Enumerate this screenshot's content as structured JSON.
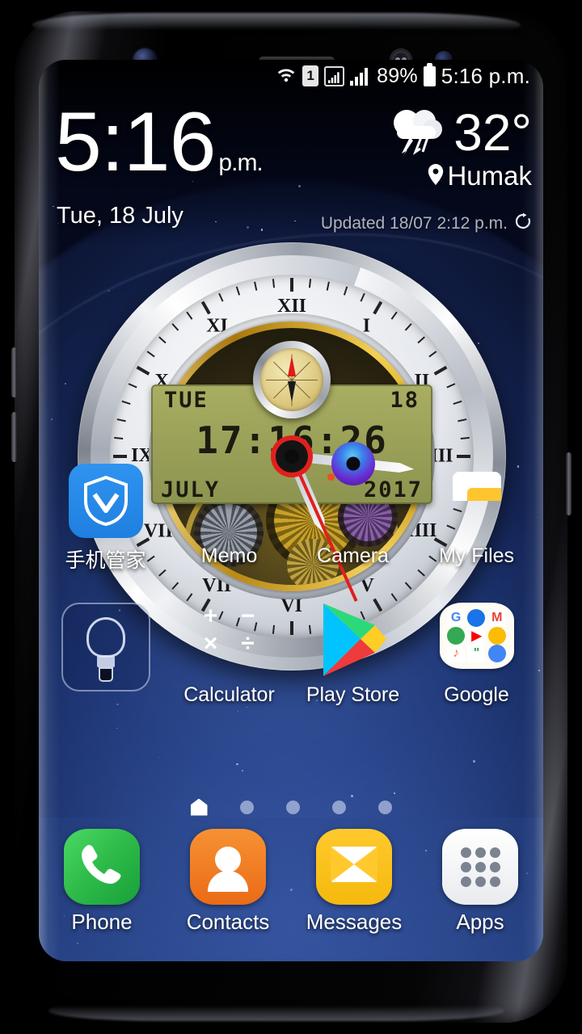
{
  "status_bar": {
    "wifi_icon": "wifi-icon",
    "sim_label": "1",
    "signal_icon_1": "signal-boxed-icon",
    "signal_icon_2": "signal-bars-icon",
    "battery_percent": "89%",
    "battery_icon": "battery-icon",
    "time": "5:16 p.m."
  },
  "clock_widget": {
    "time": "5:16",
    "ampm": "p.m.",
    "date": "Tue, 18 July"
  },
  "weather_widget": {
    "icon": "thunderstorm-cloud-icon",
    "temperature": "32°",
    "location": "Humak",
    "location_pin_icon": "location-pin-icon",
    "updated": "Updated 18/07 2:12 p.m.",
    "refresh_icon": "refresh-icon"
  },
  "analog_clock": {
    "lcd_day": "TUE",
    "lcd_date": "18",
    "lcd_time": "17:16:26",
    "lcd_month": "JULY",
    "lcd_year": "2017",
    "roman_numerals": [
      "XII",
      "I",
      "II",
      "III",
      "IIII",
      "V",
      "VI",
      "VII",
      "VIII",
      "IX",
      "X",
      "XI"
    ],
    "compass_icon": "compass-subdial-icon",
    "hour_angle": 157,
    "minute_angle": 96,
    "second_angle": 156
  },
  "app_rows": [
    [
      {
        "name": "security-manager",
        "label": "手机管家",
        "icon": "shield-icon"
      },
      {
        "name": "memo",
        "label": "Memo",
        "icon": "notepad-icon"
      },
      {
        "name": "camera",
        "label": "Camera",
        "icon": "camera-icon"
      },
      {
        "name": "my-files",
        "label": "My Files",
        "icon": "folder-icon"
      }
    ],
    [
      {
        "name": "flashlight-widget",
        "label": "",
        "icon": "lightbulb-icon"
      },
      {
        "name": "calculator",
        "label": "Calculator",
        "icon": "calculator-icon"
      },
      {
        "name": "play-store",
        "label": "Play Store",
        "icon": "play-store-icon"
      },
      {
        "name": "google-folder",
        "label": "Google",
        "icon": "google-folder-icon"
      }
    ]
  ],
  "calculator_symbols": [
    "+",
    "−",
    "×",
    "÷"
  ],
  "google_folder_apps": [
    {
      "name": "google-search",
      "glyph": "G",
      "color": "#4285F4"
    },
    {
      "name": "chrome",
      "glyph": "",
      "color": "#1a73e8"
    },
    {
      "name": "gmail",
      "glyph": "M",
      "color": "#EA4335"
    },
    {
      "name": "maps",
      "glyph": "",
      "color": "#34A853"
    },
    {
      "name": "youtube",
      "glyph": "▶",
      "color": "#FF0000"
    },
    {
      "name": "drive",
      "glyph": "",
      "color": "#FBBC04"
    },
    {
      "name": "play-music",
      "glyph": "♪",
      "color": "#FF7043"
    },
    {
      "name": "hangouts",
      "glyph": "\"",
      "color": "#34A853"
    },
    {
      "name": "photos",
      "glyph": "",
      "color": "#4285F4"
    }
  ],
  "page_indicator": {
    "home_icon": "home-page-icon",
    "dot_count": 4,
    "current_page": 1,
    "total_pages": 5
  },
  "dock": [
    {
      "name": "phone",
      "label": "Phone",
      "icon": "phone-handset-icon"
    },
    {
      "name": "contacts",
      "label": "Contacts",
      "icon": "person-icon"
    },
    {
      "name": "messages",
      "label": "Messages",
      "icon": "envelope-icon"
    },
    {
      "name": "apps",
      "label": "Apps",
      "icon": "app-drawer-icon"
    }
  ],
  "colors": {
    "accent_blue": "#2f93f0",
    "wallpaper_blue": "#2b4586",
    "lcd_green": "#9aa058",
    "second_hand_red": "#e0201c",
    "gold_ring": "#d4a61b"
  }
}
